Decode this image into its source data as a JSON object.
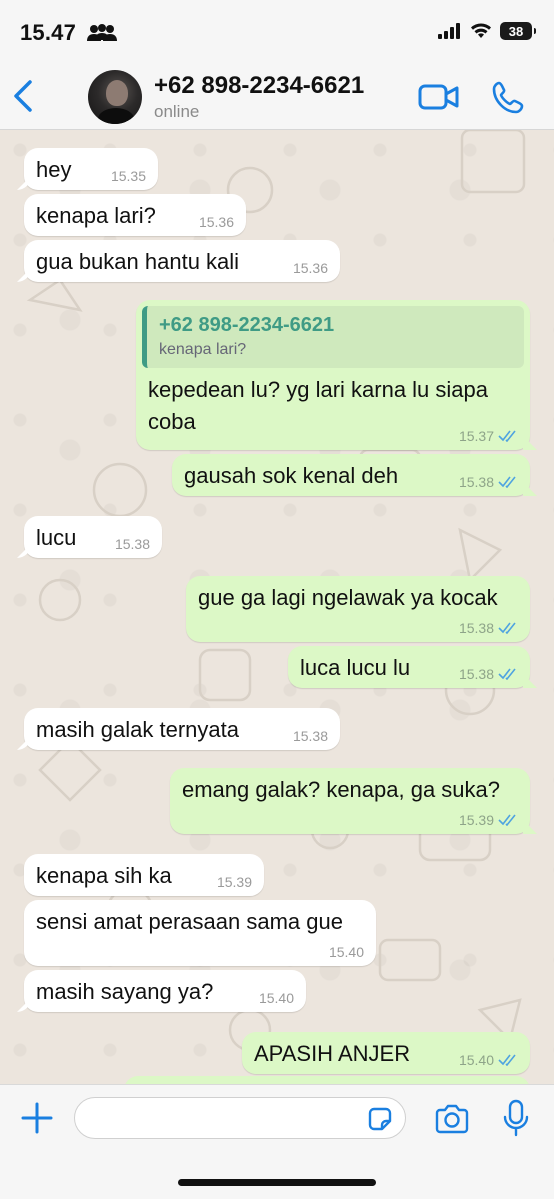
{
  "status_bar": {
    "time": "15.47",
    "battery": "38"
  },
  "header": {
    "contact_name": "+62 898-2234-6621",
    "contact_status": "online"
  },
  "messages": [
    {
      "dir": "in",
      "text": "hey",
      "time": "15.35"
    },
    {
      "dir": "in",
      "text": "kenapa lari?",
      "time": "15.36"
    },
    {
      "dir": "in",
      "text": "gua bukan hantu kali",
      "time": "15.36"
    },
    {
      "dir": "out",
      "quote_name": "+62 898-2234-6621",
      "quote_text": "kenapa lari?",
      "text": "kepedean lu? yg lari karna lu siapa coba",
      "time": "15.37"
    },
    {
      "dir": "out",
      "text": "gausah sok kenal deh",
      "time": "15.38"
    },
    {
      "dir": "in",
      "text": "lucu",
      "time": "15.38"
    },
    {
      "dir": "out",
      "text": "gue ga lagi ngelawak ya kocak",
      "time": "15.38"
    },
    {
      "dir": "out",
      "text": "luca lucu lu",
      "time": "15.38"
    },
    {
      "dir": "in",
      "text": "masih galak ternyata",
      "time": "15.38"
    },
    {
      "dir": "out",
      "text": "emang galak? kenapa, ga suka?",
      "time": "15.39"
    },
    {
      "dir": "in",
      "text": "kenapa sih ka",
      "time": "15.39"
    },
    {
      "dir": "in",
      "text": "sensi amat perasaan sama gue",
      "time": "15.40"
    },
    {
      "dir": "in",
      "text": "masih sayang ya?",
      "time": "15.40"
    },
    {
      "dir": "out",
      "text": "APASIH ANJER",
      "time": "15.40"
    }
  ],
  "composer": {
    "placeholder": ""
  },
  "colors": {
    "accent": "#1a7fe0",
    "incoming_bubble": "#ffffff",
    "outgoing_bubble": "#dcf8c6",
    "read_ticks": "#4fa3e0",
    "quote_accent": "#3f9b85",
    "chat_background": "#ece5dd"
  },
  "icons": [
    "people-icon",
    "signal-icon",
    "wifi-icon",
    "battery-icon",
    "back-chevron-icon",
    "video-camera-icon",
    "phone-icon",
    "plus-icon",
    "sticker-icon",
    "camera-icon",
    "microphone-icon",
    "double-check-icon"
  ]
}
